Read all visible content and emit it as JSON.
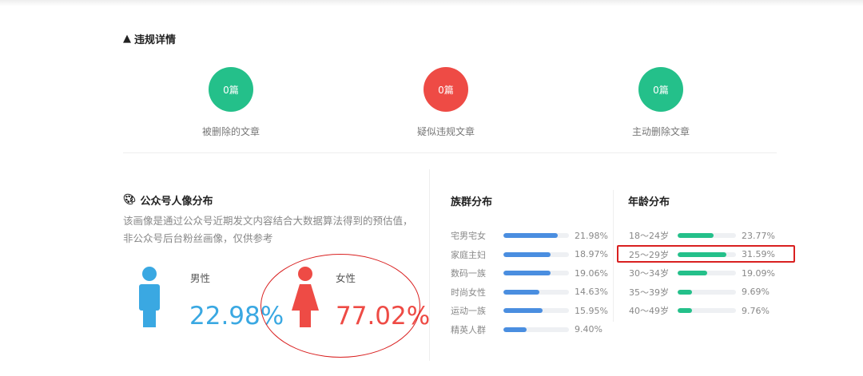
{
  "violations": {
    "title": "违规详情",
    "items": [
      {
        "count": "0篇",
        "label": "被删除的文章",
        "color": "#24c08a"
      },
      {
        "count": "0篇",
        "label": "疑似违规文章",
        "color": "#ee4b45"
      },
      {
        "count": "0篇",
        "label": "主动删除文章",
        "color": "#24c08a"
      }
    ]
  },
  "portrait": {
    "title": "公众号人像分布",
    "description": "该画像是通过公众号近期发文内容结合大数据算法得到的预估值，非公众号后台粉丝画像，仅供参考",
    "male": {
      "label": "男性",
      "percent": "22.98%",
      "color": "#3aa8e2"
    },
    "female": {
      "label": "女性",
      "percent": "77.02%",
      "color": "#ee4b45"
    }
  },
  "groups": {
    "title": "族群分布",
    "color": "#4a8ee0",
    "items": [
      {
        "label": "宅男宅女",
        "value": "21.98%",
        "fill": 0.83
      },
      {
        "label": "家庭主妇",
        "value": "18.97%",
        "fill": 0.72
      },
      {
        "label": "数码一族",
        "value": "19.06%",
        "fill": 0.72
      },
      {
        "label": "时尚女性",
        "value": "14.63%",
        "fill": 0.55
      },
      {
        "label": "运动一族",
        "value": "15.95%",
        "fill": 0.6
      },
      {
        "label": "精英人群",
        "value": "9.40%",
        "fill": 0.35
      }
    ]
  },
  "ages": {
    "title": "年龄分布",
    "color": "#24c08a",
    "items": [
      {
        "label": "18～24岁",
        "value": "23.77%",
        "fill": 0.62
      },
      {
        "label": "25～29岁",
        "value": "31.59%",
        "fill": 0.84
      },
      {
        "label": "30～34岁",
        "value": "19.09%",
        "fill": 0.5
      },
      {
        "label": "35～39岁",
        "value": "9.69%",
        "fill": 0.25
      },
      {
        "label": "40～49岁",
        "value": "9.76%",
        "fill": 0.25
      }
    ]
  }
}
